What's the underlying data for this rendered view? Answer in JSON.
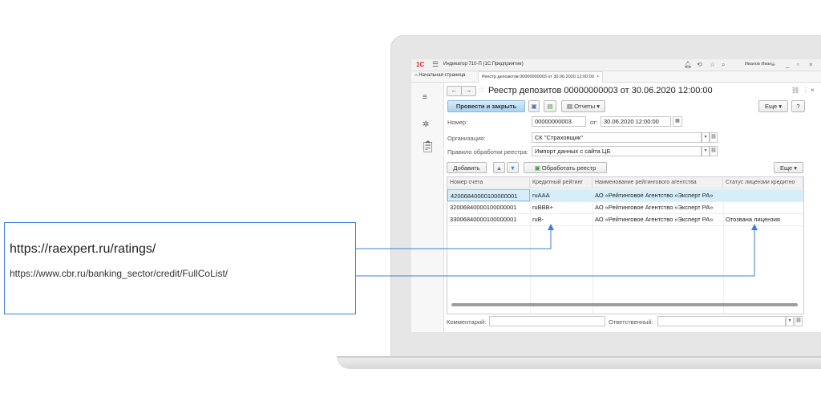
{
  "app": {
    "logo": "1С",
    "title": "Индикатор 710-П  (1С:Предприятие)",
    "user": "Иванов Иван",
    "tabs": {
      "home": "Начальная страница",
      "document": "Реестр депозитов 00000000003 от 30.06.2020 12:00:00"
    }
  },
  "form": {
    "title": "Реестр депозитов 00000000003 от 30.06.2020 12:00:00",
    "post_close": "Провести и закрыть",
    "reports": "Отчеты",
    "more": "Еще",
    "help": "?",
    "number_label": "Номер:",
    "number_value": "00000000003",
    "date_label": "от:",
    "date_value": "30.06.2020 12:00:00",
    "org_label": "Организация:",
    "org_value": "СК \"Страховщик\"",
    "rule_label": "Правило обработки реестра:",
    "rule_value": "Импорт данных с сайта ЦБ",
    "add": "Добавить",
    "process": "Обработать реестр",
    "table_more": "Еще",
    "comment_label": "Комментарий:",
    "responsible_label": "Ответственный:"
  },
  "table": {
    "headers": [
      "Номер счета",
      "Кредитный рейтинг",
      "Наименование рейтингового агентства",
      "Статус лицензии кредитно"
    ],
    "rows": [
      {
        "account": "42006840000100000001",
        "rating": "ruAAA",
        "agency": "АО «Рейтинговое Агентство «Эксперт РА»",
        "status": ""
      },
      {
        "account": "32006840000100000001",
        "rating": "ruBBB+",
        "agency": "АО «Рейтинговое Агентство «Эксперт РА»",
        "status": ""
      },
      {
        "account": "33006840000100000001",
        "rating": "ruB-",
        "agency": "АО «Рейтинговое Агентство «Эксперт РА»",
        "status": "Отозвана лицензия"
      }
    ]
  },
  "callout": {
    "url1": "https://raexpert.ru/ratings/",
    "url2": "https://www.cbr.ru/banking_sector/credit/FullCoList/"
  },
  "colors": {
    "accent_line": "#3d7fd8",
    "selected_row": "#d6eefa",
    "post_button": "#a9d2f0",
    "logo": "#e0231c"
  }
}
